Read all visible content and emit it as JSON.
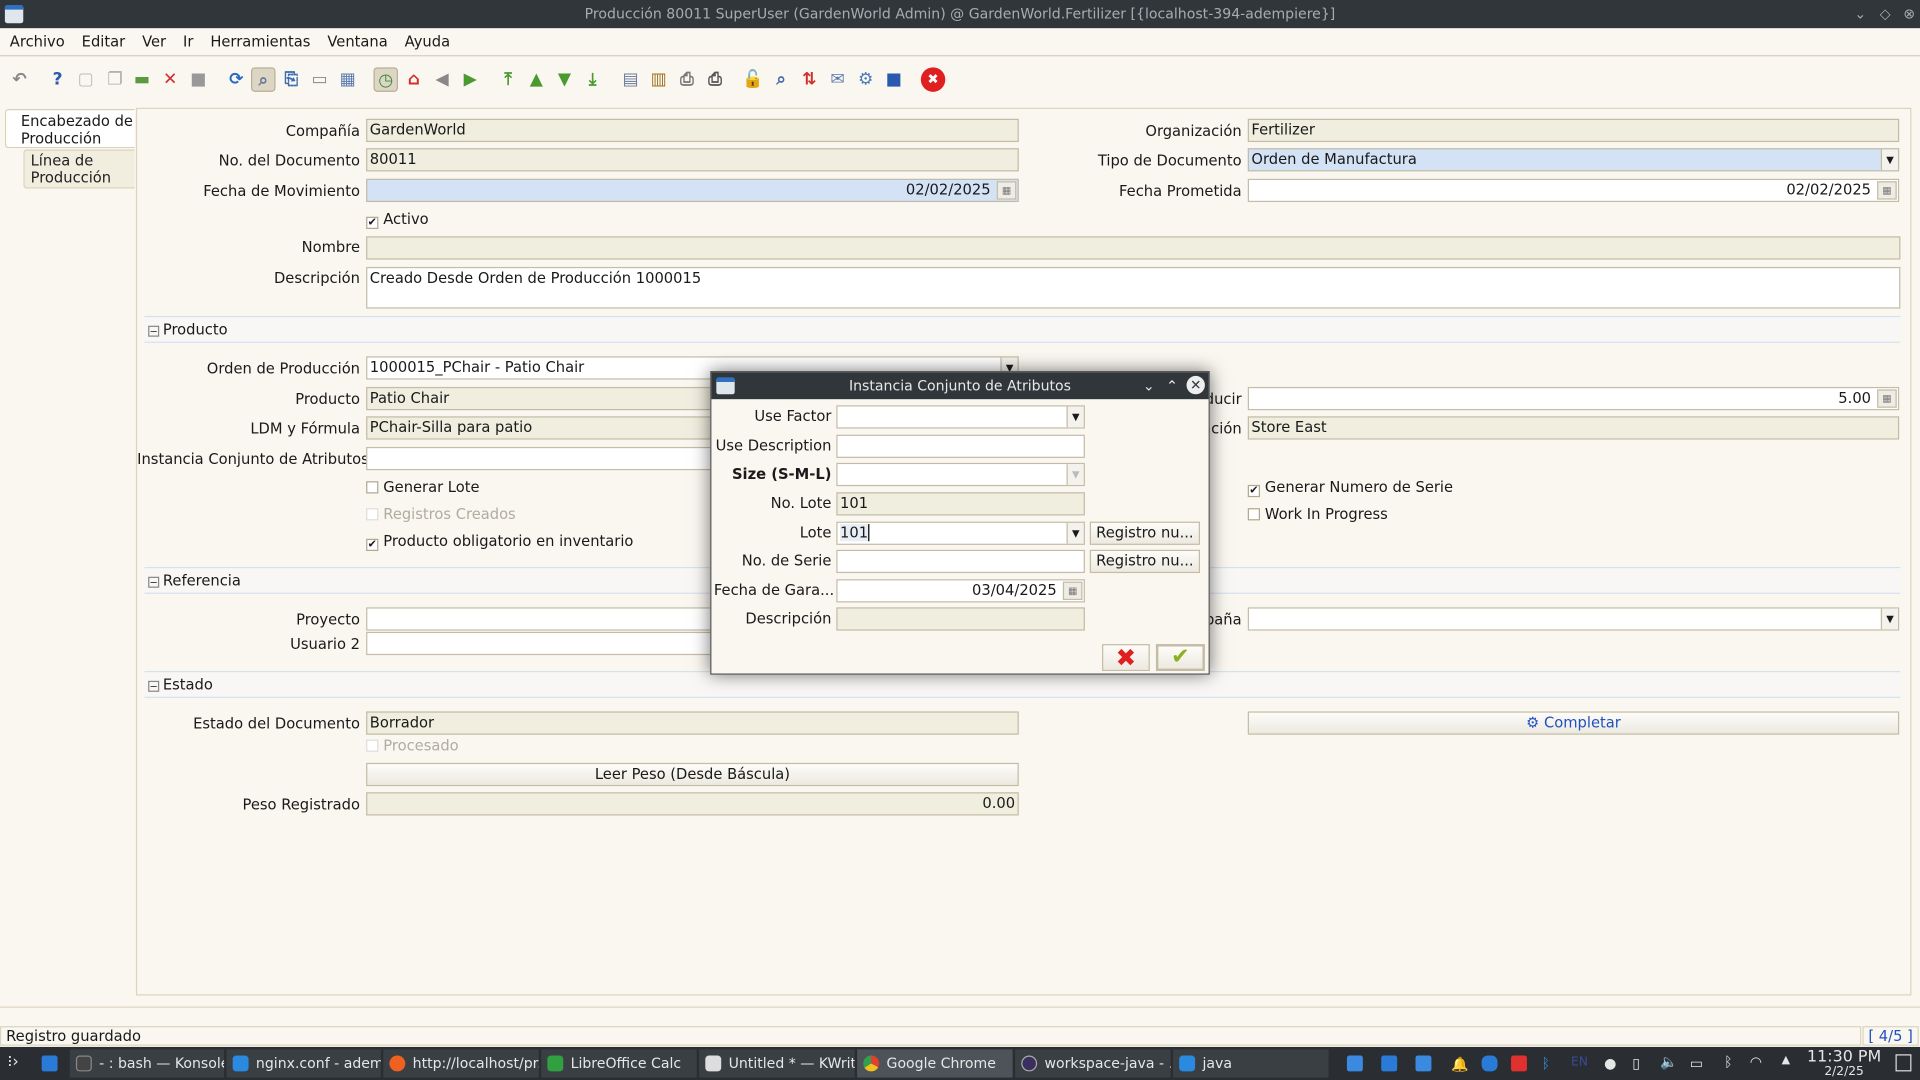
{
  "window": {
    "title": "Producción 80011 SuperUser (GardenWorld Admin) @ GardenWorld.Fertilizer [{localhost-394-adempiere}]"
  },
  "menu": [
    "Archivo",
    "Editar",
    "Ver",
    "Ir",
    "Herramientas",
    "Ventana",
    "Ayuda"
  ],
  "toolbar": [
    "undo-icon",
    "help-icon",
    "new-record-icon",
    "copy-record-icon",
    "save-icon",
    "delete-icon",
    "save-disabled-icon",
    "refresh-icon",
    "find-icon",
    "attachment-icon",
    "chat-icon",
    "grid-toggle-icon",
    "history-icon",
    "home-icon",
    "back-icon",
    "forward-icon",
    "first-record-icon",
    "previous-record-icon",
    "next-record-icon",
    "last-record-icon",
    "report-icon",
    "archive-icon",
    "print-preview-icon",
    "print-icon",
    "lock-icon",
    "zoom-across-icon",
    "workflow-icon",
    "request-icon",
    "process-icon",
    "product-info-icon",
    "exit-icon"
  ],
  "tabs": [
    {
      "label": "Encabezado de Producción",
      "selected": true
    },
    {
      "label": "Línea de Producción",
      "selected": false
    }
  ],
  "header": {
    "company": {
      "label": "Compañía",
      "value": "GardenWorld"
    },
    "org": {
      "label": "Organización",
      "value": "Fertilizer"
    },
    "doc_no": {
      "label": "No. del Documento",
      "value": "80011"
    },
    "doc_type": {
      "label": "Tipo de Documento",
      "value": "Orden de Manufactura"
    },
    "movement_date": {
      "label": "Fecha de Movimiento",
      "value": "02/02/2025"
    },
    "promised_date": {
      "label": "Fecha Prometida",
      "value": "02/02/2025"
    },
    "active": {
      "label": "Activo",
      "checked": true
    },
    "name": {
      "label": "Nombre",
      "value": ""
    },
    "description": {
      "label": "Descripción",
      "value": "Creado Desde Orden de Producción 1000015"
    }
  },
  "product_section": {
    "title": "Producto",
    "order": {
      "label": "Orden de Producción",
      "value": "1000015_PChair - Patio Chair"
    },
    "product": {
      "label": "Producto",
      "value": "Patio Chair"
    },
    "bom": {
      "label": "LDM y Fórmula",
      "value": "PChair-Silla para patio"
    },
    "asi": {
      "label": "Instancia Conjunto de Atributos",
      "value": ""
    },
    "qty": {
      "label": "ducir",
      "value": "5.00"
    },
    "locator": {
      "label": "ación",
      "value": "Store East"
    },
    "gen_lot": {
      "label": "Generar Lote",
      "checked": false
    },
    "records_created": {
      "label": "Registros Creados",
      "checked": false
    },
    "mandatory_inv": {
      "label": "Producto obligatorio en inventario",
      "checked": true
    },
    "gen_serial": {
      "label": "Generar Numero de Serie",
      "checked": true
    },
    "wip": {
      "label": "Work In Progress",
      "checked": false
    }
  },
  "reference_section": {
    "title": "Referencia",
    "project": {
      "label": "Proyecto",
      "value": ""
    },
    "user2": {
      "label": "Usuario 2",
      "value": ""
    },
    "campaign": {
      "label": "paña",
      "value": ""
    }
  },
  "status_section": {
    "title": "Estado",
    "doc_status": {
      "label": "Estado del Documento",
      "value": "Borrador"
    },
    "processed": {
      "label": "Procesado",
      "checked": false
    },
    "read_weight": "Leer Peso (Desde Báscula)",
    "weight": {
      "label": "Peso Registrado",
      "value": "0.00"
    },
    "complete": "Completar"
  },
  "dialog": {
    "title": "Instancia Conjunto de Atributos",
    "use_factor": {
      "label": "Use Factor",
      "value": ""
    },
    "use_description": {
      "label": "Use Description",
      "value": ""
    },
    "size": {
      "label": "Size (S-M-L)",
      "value": ""
    },
    "lot_no": {
      "label": "No. Lote",
      "value": "101"
    },
    "lot": {
      "label": "Lote",
      "value": "101"
    },
    "serial": {
      "label": "No. de Serie",
      "value": ""
    },
    "guarantee": {
      "label": "Fecha de Gara...",
      "value": "03/04/2025"
    },
    "description": {
      "label": "Descripción",
      "value": ""
    },
    "new_record": "Registro nu..."
  },
  "statusbar": {
    "message": "Registro guardado",
    "record": "[ 4/5 ]"
  },
  "taskbar": {
    "items": [
      "- : bash — Konsole",
      "nginx.conf - adem...",
      "http://localhost/pr...",
      "LibreOffice Calc",
      "Untitled * — KWrite",
      "Google Chrome",
      "workspace-java - ...",
      "java"
    ],
    "lang": "EN",
    "time": "11:30 PM",
    "date": "2/2/25"
  },
  "colors": {
    "mandatory": "#d3e2f5",
    "readonly": "#f0eedf",
    "titlebar": "#31363b",
    "link": "#2050c0",
    "cancel": "#e02020",
    "ok": "#8ab020"
  }
}
